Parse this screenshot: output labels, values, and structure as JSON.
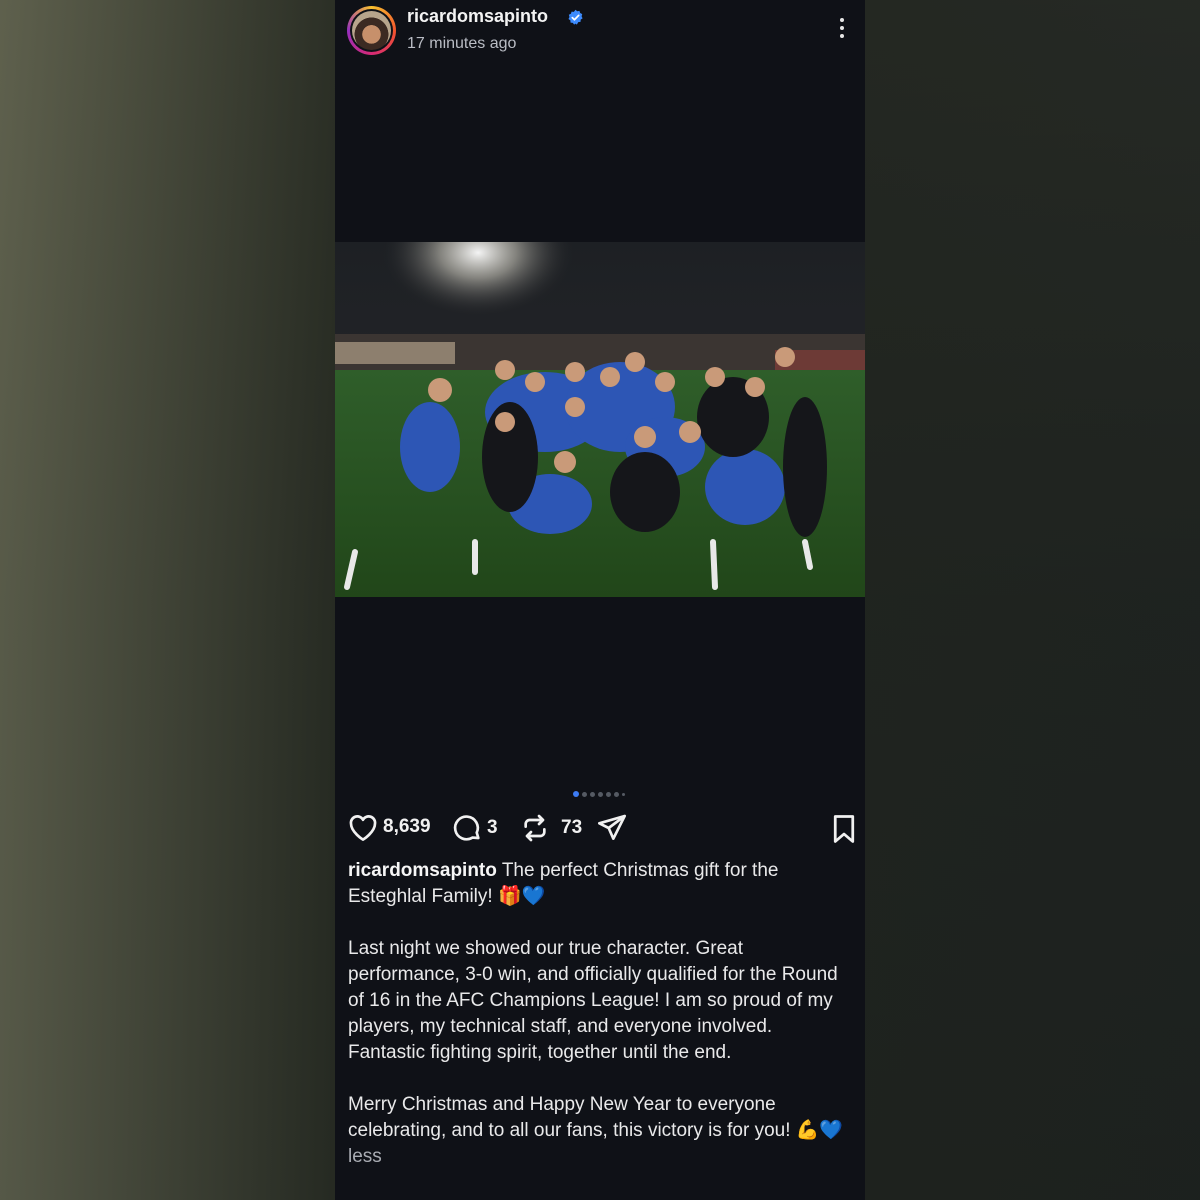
{
  "post": {
    "username": "ricardomsapinto",
    "time_ago": "17 minutes ago",
    "verified_icon": "verified-badge-icon",
    "carousel": {
      "count": 7,
      "active_index": 0
    },
    "actions": {
      "likes": "8,639",
      "comments": "3",
      "reposts": "73"
    },
    "caption": {
      "username": "ricardomsapinto",
      "line1": "The perfect Christmas gift for the Esteghlal Family! 🎁💙",
      "paragraph2": "Last night we showed our true character. Great performance, 3-0 win, and officially qualified for the Round of 16 in the AFC Champions League! I am so proud of my players, my technical staff, and everyone involved. Fantastic fighting spirit, together until the end.",
      "paragraph3": "Merry Christmas and Happy New Year to everyone celebrating, and to all our fans, this victory is for you! 💪💙",
      "less_label": "less"
    }
  },
  "colors": {
    "background": "#0f1117",
    "verified": "#3d8bfd",
    "carousel_active": "#3d7cf5"
  }
}
